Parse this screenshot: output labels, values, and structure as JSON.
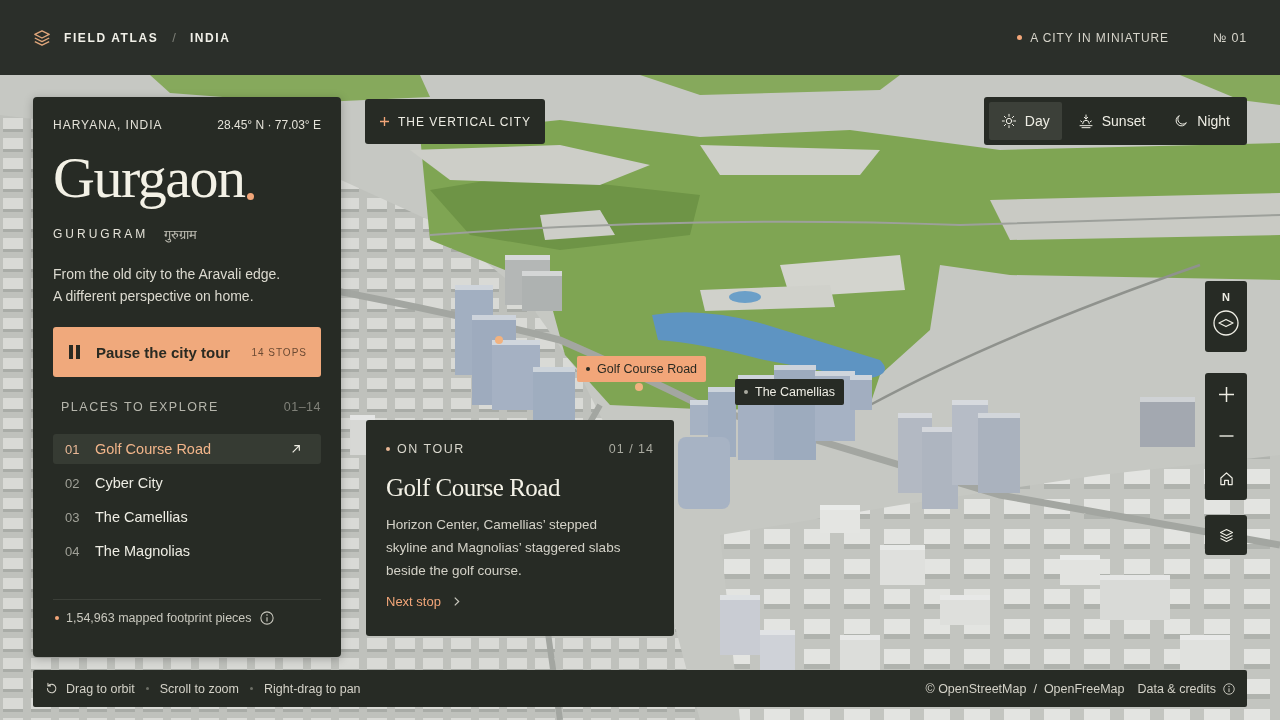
{
  "header": {
    "brand": "FIELD ATLAS",
    "separator": "/",
    "region": "INDIA",
    "tagline": "A CITY IN MINIATURE",
    "issue": "№ 01"
  },
  "city_panel": {
    "region": "HARYANA, INDIA",
    "coordinates": "28.45° N · 77.03° E",
    "title": "Gurgaon",
    "subtitle": "GURUGRAM",
    "subtitle_native": "गुरुग्राम",
    "description": [
      "From the old city to the Aravali edge.",
      "A different perspective on home."
    ],
    "tour_button": {
      "label": "Pause the city tour",
      "stops": "14 STOPS",
      "playing": true
    },
    "places": {
      "heading": "PLACES TO EXPLORE",
      "range": "01–14",
      "items": [
        {
          "number": "01",
          "name": "Golf Course Road",
          "selected": true
        },
        {
          "number": "02",
          "name": "Cyber City",
          "selected": false
        },
        {
          "number": "03",
          "name": "The Camellias",
          "selected": false
        },
        {
          "number": "04",
          "name": "The Magnolias",
          "selected": false
        }
      ]
    },
    "footprint": "1,54,963 mapped footprint pieces"
  },
  "map": {
    "chapter": "THE VERTICAL CITY",
    "time_modes": [
      {
        "label": "Day",
        "kind": "day",
        "selected": true
      },
      {
        "label": "Sunset",
        "kind": "sunset",
        "selected": false
      },
      {
        "label": "Night",
        "kind": "night",
        "selected": false
      }
    ],
    "compass": "N",
    "markers": [
      {
        "label": "Golf Course Road",
        "selected": true
      },
      {
        "label": "The Camellias",
        "selected": false
      }
    ]
  },
  "tour_card": {
    "status": "ON TOUR",
    "counter": "01 / 14",
    "title": "Golf Course Road",
    "text": "Horizon Center, Camellias’ stepped skyline and Magnolias’ staggered slabs beside the golf course.",
    "link": "Next stop"
  },
  "hint_bar": {
    "hints": [
      "Drag to orbit",
      "Scroll to zoom",
      "Right-drag to pan"
    ],
    "attribution": [
      "© OpenStreetMap",
      "OpenFreeMap"
    ],
    "attribution_separator": "/",
    "credits": "Data & credits"
  }
}
